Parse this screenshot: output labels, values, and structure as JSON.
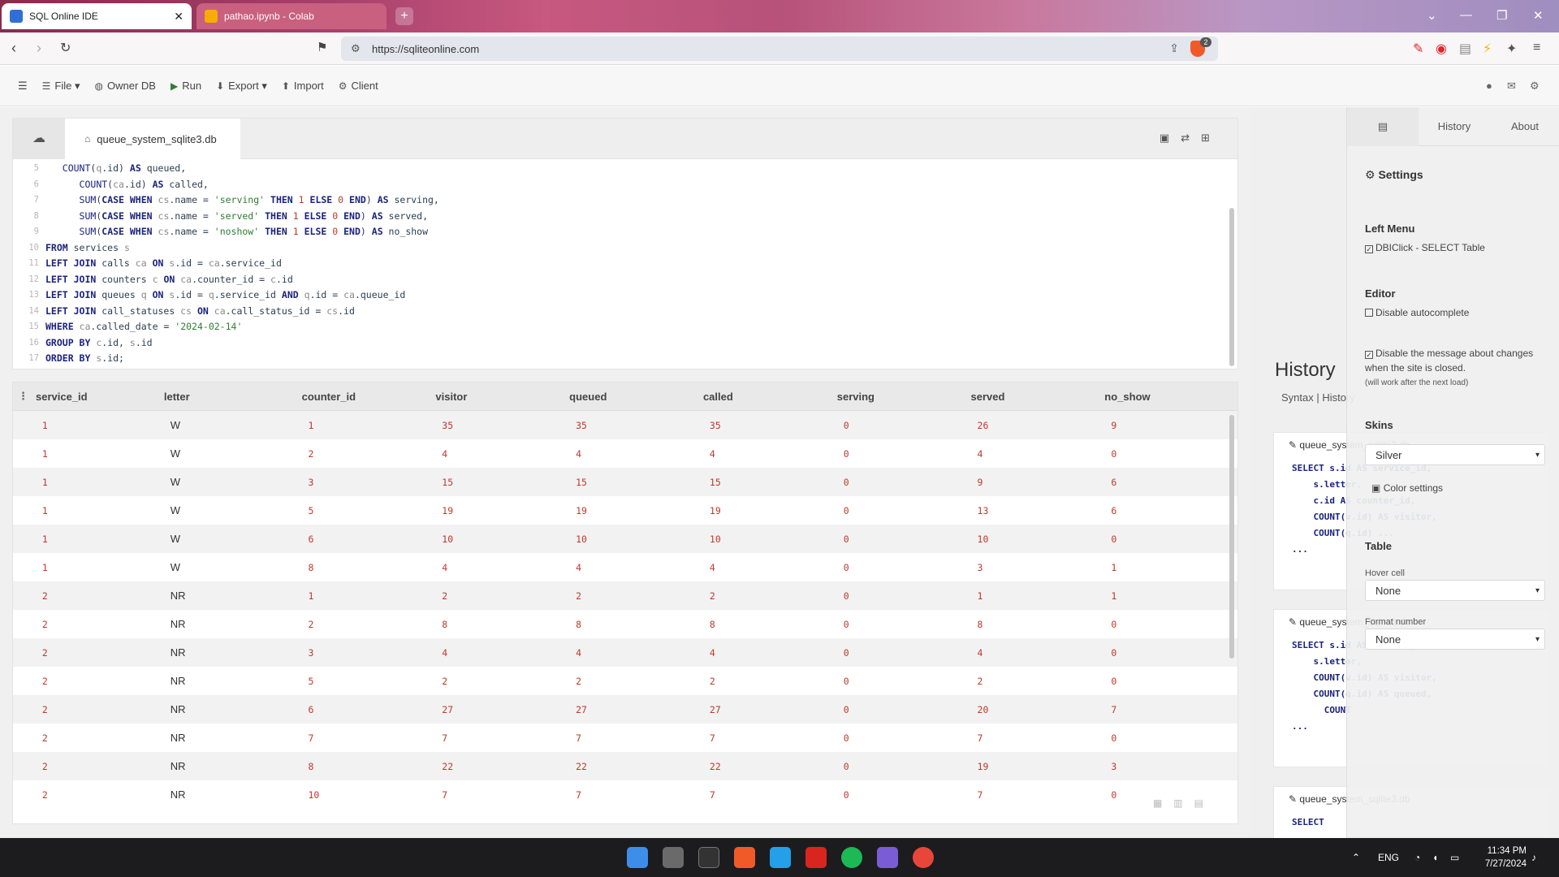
{
  "browser": {
    "tabs": [
      {
        "title": "SQL Online IDE",
        "active": true
      },
      {
        "title": "pathao.ipynb - Colab",
        "active": false
      }
    ],
    "url": "https://sqliteonline.com",
    "shield_badge": "2"
  },
  "toolbar": {
    "file": "File",
    "owner_db": "Owner DB",
    "run": "Run",
    "export": "Export",
    "import": "Import",
    "client": "Client"
  },
  "editor": {
    "db_tab": "queue_system_sqlite3.db"
  },
  "results": {
    "columns": [
      "service_id",
      "letter",
      "counter_id",
      "visitor",
      "queued",
      "called",
      "serving",
      "served",
      "no_show"
    ],
    "rows": [
      [
        "1",
        "W",
        "1",
        "35",
        "35",
        "35",
        "0",
        "26",
        "9"
      ],
      [
        "1",
        "W",
        "2",
        "4",
        "4",
        "4",
        "0",
        "4",
        "0"
      ],
      [
        "1",
        "W",
        "3",
        "15",
        "15",
        "15",
        "0",
        "9",
        "6"
      ],
      [
        "1",
        "W",
        "5",
        "19",
        "19",
        "19",
        "0",
        "13",
        "6"
      ],
      [
        "1",
        "W",
        "6",
        "10",
        "10",
        "10",
        "0",
        "10",
        "0"
      ],
      [
        "1",
        "W",
        "8",
        "4",
        "4",
        "4",
        "0",
        "3",
        "1"
      ],
      [
        "2",
        "NR",
        "1",
        "2",
        "2",
        "2",
        "0",
        "1",
        "1"
      ],
      [
        "2",
        "NR",
        "2",
        "8",
        "8",
        "8",
        "0",
        "8",
        "0"
      ],
      [
        "2",
        "NR",
        "3",
        "4",
        "4",
        "4",
        "0",
        "4",
        "0"
      ],
      [
        "2",
        "NR",
        "5",
        "2",
        "2",
        "2",
        "0",
        "2",
        "0"
      ],
      [
        "2",
        "NR",
        "6",
        "27",
        "27",
        "27",
        "0",
        "20",
        "7"
      ],
      [
        "2",
        "NR",
        "7",
        "7",
        "7",
        "7",
        "0",
        "7",
        "0"
      ],
      [
        "2",
        "NR",
        "8",
        "22",
        "22",
        "22",
        "0",
        "19",
        "3"
      ],
      [
        "2",
        "NR",
        "10",
        "7",
        "7",
        "7",
        "0",
        "7",
        "0"
      ]
    ]
  },
  "history": {
    "title": "History",
    "links": "Syntax  |  History",
    "cards": [
      {
        "name": "queue_system_sqlite3.db",
        "code": "SELECT s.id AS service_id,\n    s.letter,\n    c.id AS counter_id,\n    COUNT(v.id) AS visitor,\n    COUNT(q.id) ...\n..."
      },
      {
        "name": "queue_system_sqlite3.db",
        "code": "SELECT s.id AS service_id,\n    s.letter,\n    COUNT(v.id) AS visitor,\n    COUNT(q.id) AS queued,\n      COUNT\n..."
      },
      {
        "name": "queue_system_sqlite3.db",
        "code": "SELECT"
      }
    ]
  },
  "settings": {
    "tabs": [
      "History",
      "About"
    ],
    "title": "Settings",
    "left_menu": {
      "heading": "Left Menu",
      "option": "DBIClick - SELECT Table"
    },
    "editor": {
      "heading": "Editor",
      "opt1": "Disable autocomplete",
      "opt2": "Disable the message about changes when the site is closed.",
      "note": "(will work after the next load)"
    },
    "skins": {
      "heading": "Skins",
      "value": "Silver",
      "color": "Color settings"
    },
    "table": {
      "heading": "Table",
      "hover_label": "Hover cell",
      "hover_value": "None",
      "format_label": "Format number",
      "format_value": "None"
    }
  },
  "taskbar": {
    "lang": "ENG",
    "time": "11:34 PM",
    "date": "7/27/2024"
  }
}
